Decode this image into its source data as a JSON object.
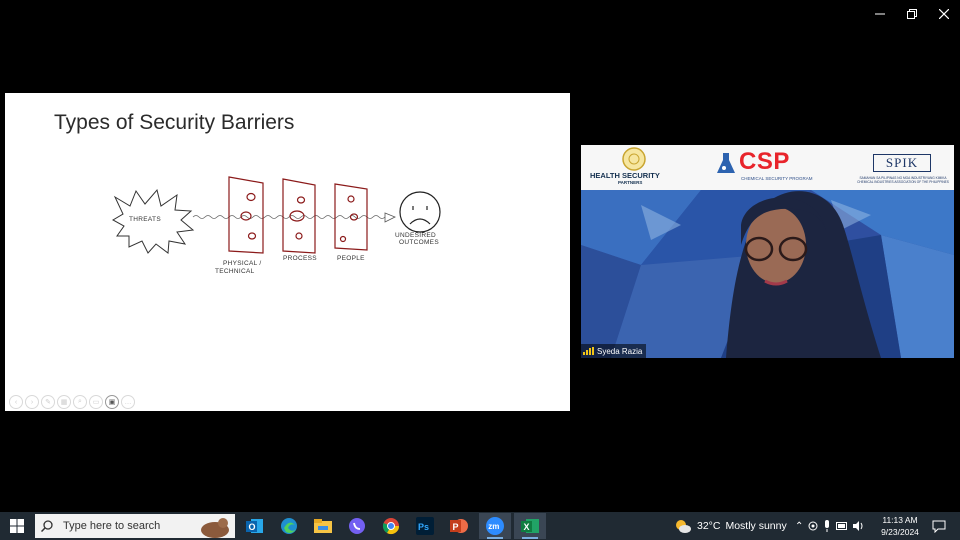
{
  "window": {
    "minimize_label": "minimize",
    "restore_label": "restore",
    "close_label": "close"
  },
  "slide": {
    "title": "Types of Security Barriers",
    "threats_label": "THREATS",
    "barriers": [
      "PHYSICAL /",
      "TECHNICAL",
      "PROCESS",
      "PEOPLE"
    ],
    "outcome_line1": "UNDESIRED",
    "outcome_line2": "OUTCOMES"
  },
  "video": {
    "participant_name": "Syeda Razia",
    "banner": {
      "left_logo_text": "HEALTH SECURITY",
      "left_logo_sub": "PARTNERS",
      "center_logo_text": "CSP",
      "center_logo_sub": "CHEMICAL SECURITY PROGRAM",
      "right_logo_text": "SPIK",
      "right_logo_sub": "SAMAHAN SA PILIPINAS NG MGA INDUSTRIYANG KIMIKA  CHEMICAL INDUSTRIES ASSOCIATION OF THE PHILIPPINES"
    }
  },
  "taskbar": {
    "search_placeholder": "Type here to search",
    "apps": [
      "outlook-icon",
      "edge-icon",
      "file-explorer-icon",
      "viber-icon",
      "chrome-icon",
      "photoshop-icon",
      "powerpoint-icon",
      "zoom-icon",
      "excel-icon"
    ],
    "weather": {
      "temp": "32°C",
      "condition": "Mostly sunny"
    },
    "time": "11:13 AM",
    "date": "9/23/2024"
  },
  "colors": {
    "taskbar": "#202a33",
    "barrier_stroke": "#8b1a1a",
    "accent": "#e8242b"
  }
}
